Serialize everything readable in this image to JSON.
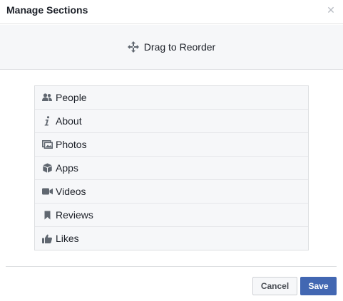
{
  "dialog": {
    "title": "Manage Sections",
    "close_icon": "close-icon"
  },
  "drag": {
    "icon": "move-arrows-icon",
    "label": "Drag to Reorder"
  },
  "sections": [
    {
      "label": "People",
      "icon": "people-icon"
    },
    {
      "label": "About",
      "icon": "info-icon"
    },
    {
      "label": "Photos",
      "icon": "photos-icon"
    },
    {
      "label": "Apps",
      "icon": "apps-cube-icon"
    },
    {
      "label": "Videos",
      "icon": "video-camera-icon"
    },
    {
      "label": "Reviews",
      "icon": "bookmark-icon"
    },
    {
      "label": "Likes",
      "icon": "thumbs-up-icon"
    }
  ],
  "footer": {
    "cancel_label": "Cancel",
    "save_label": "Save"
  },
  "colors": {
    "primary": "#4267b2",
    "icon_gray": "#606770",
    "panel_bg": "#f6f7f9"
  }
}
